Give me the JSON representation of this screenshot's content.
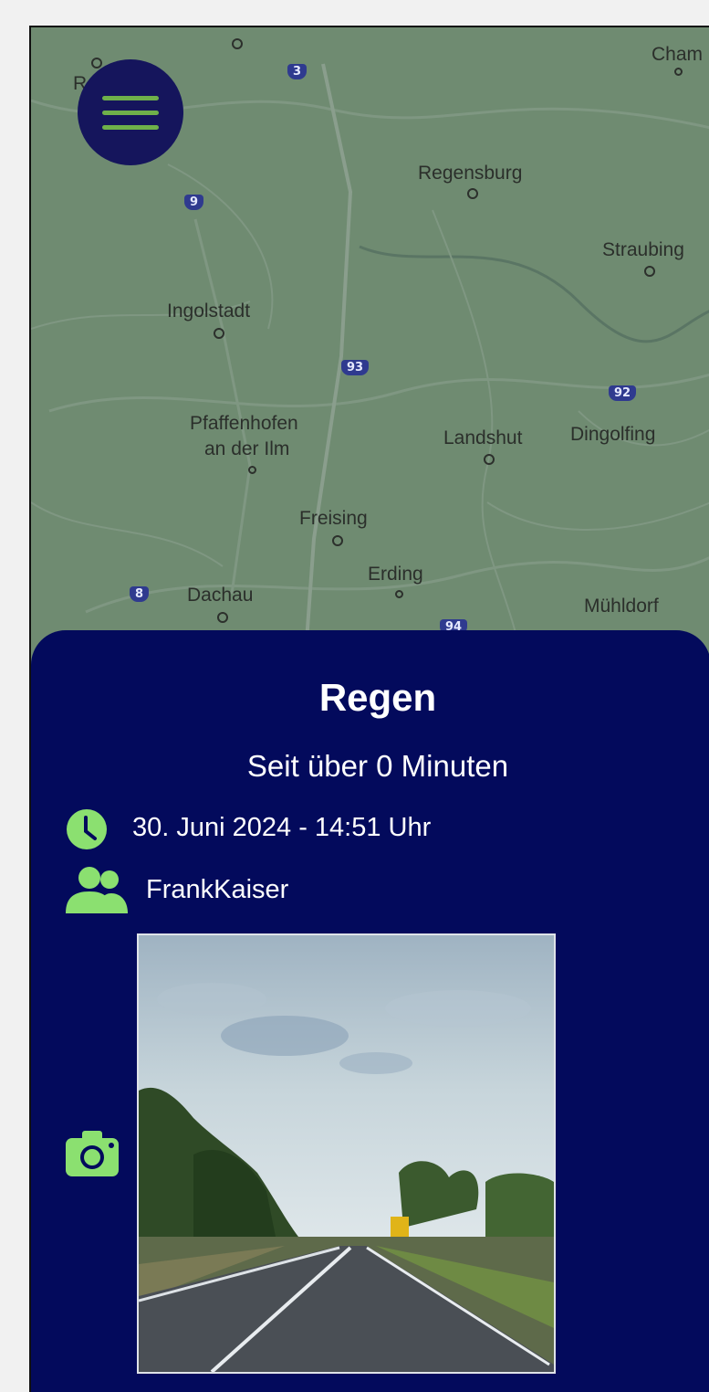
{
  "map": {
    "cities": [
      {
        "name": "Cham",
        "id": "cham"
      },
      {
        "name": "Regensburg",
        "id": "regensburg"
      },
      {
        "name": "Straubing",
        "id": "straubing"
      },
      {
        "name": "Ingolstadt",
        "id": "ingolstadt"
      },
      {
        "name": "Pfaffenhofen",
        "id": "pfaffenhofen-1"
      },
      {
        "name": "an der Ilm",
        "id": "pfaffenhofen-2"
      },
      {
        "name": "Landshut",
        "id": "landshut"
      },
      {
        "name": "Dingolfing",
        "id": "dingolfing"
      },
      {
        "name": "Freising",
        "id": "freising"
      },
      {
        "name": "Erding",
        "id": "erding"
      },
      {
        "name": "Dachau",
        "id": "dachau"
      },
      {
        "name": "Mühldorf",
        "id": "muehldorf"
      },
      {
        "name": "R",
        "id": "r-partial"
      }
    ],
    "road_shields": [
      "3",
      "9",
      "93",
      "92",
      "8",
      "94"
    ]
  },
  "menu": {
    "icon": "hamburger-menu-icon"
  },
  "report": {
    "title": "Regen",
    "subtitle": "Seit über 0 Minuten",
    "datetime": "30. Juni 2024 - 14:51 Uhr",
    "user": "FrankKaiser",
    "icons": {
      "time": "clock-icon",
      "user": "users-icon",
      "photo": "camera-icon"
    }
  },
  "colors": {
    "sheet_bg": "#030a5c",
    "accent_green": "#8be070",
    "menu_bg": "#15155c",
    "map_bg": "#6e8a70"
  }
}
